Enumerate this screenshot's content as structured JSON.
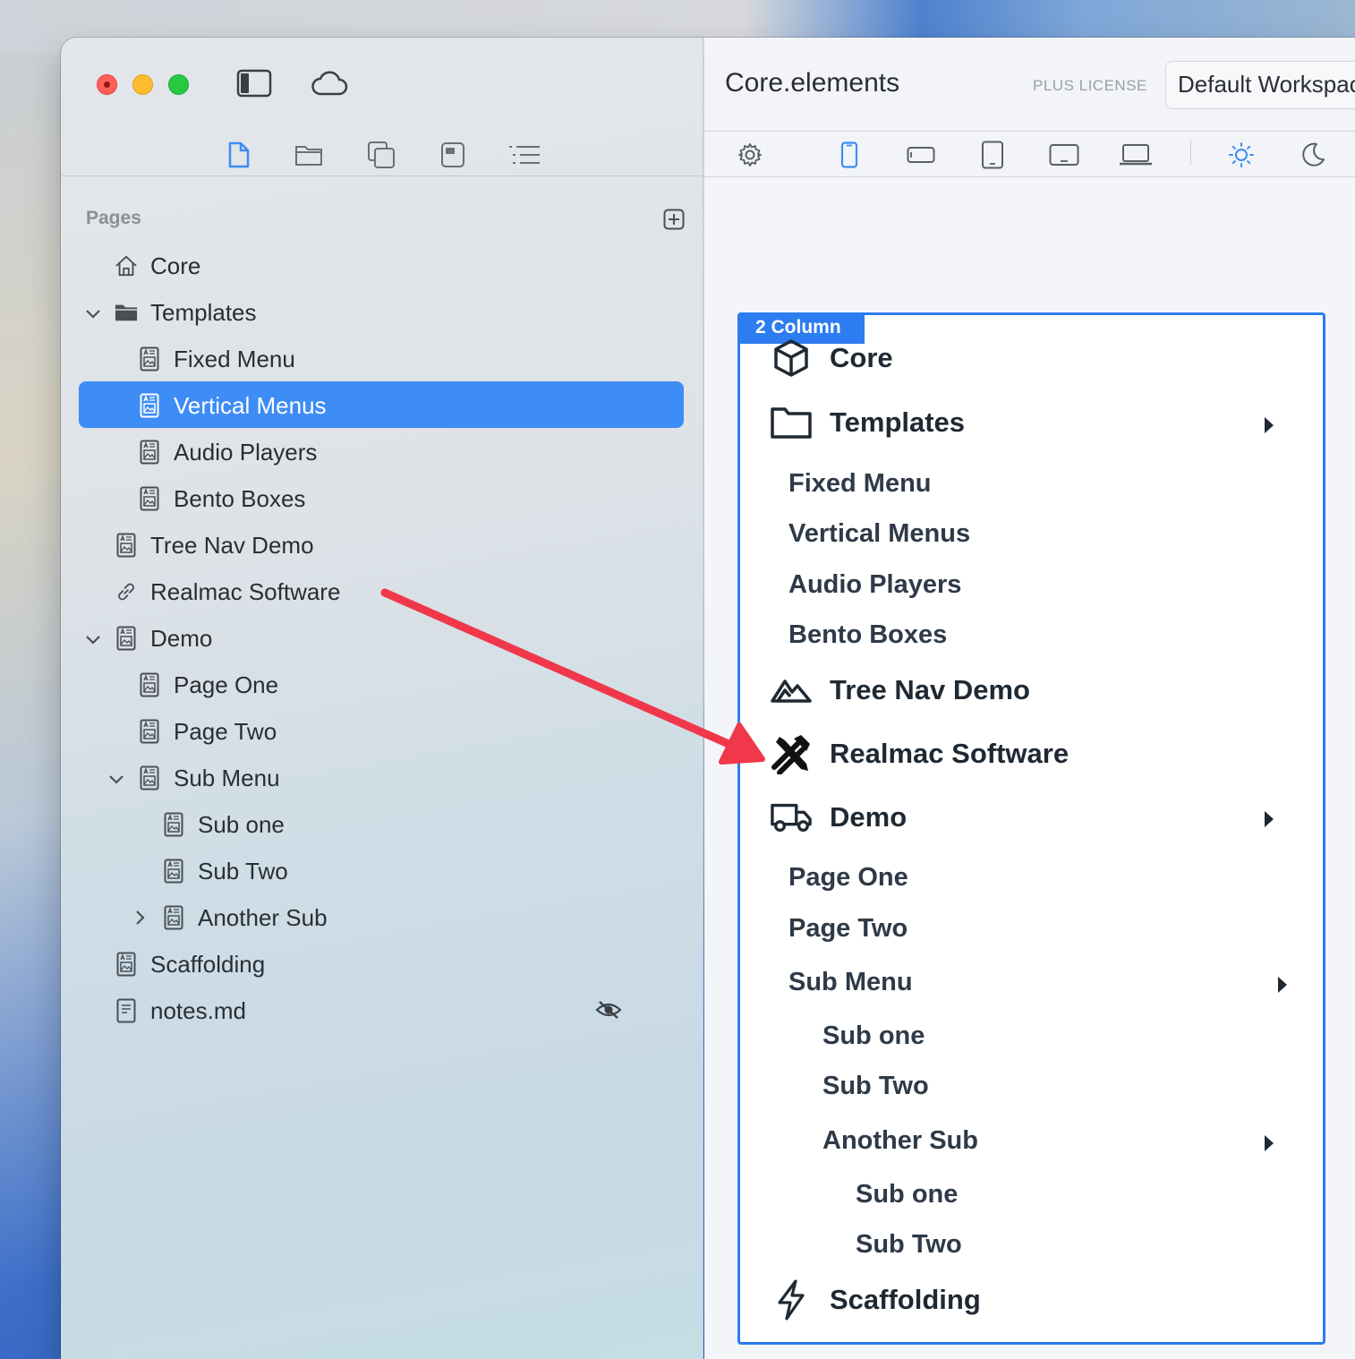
{
  "window": {
    "title": "Core.elements",
    "license": "PLUS LICENSE",
    "workspace": "Default Workspace"
  },
  "toolbar": {
    "left_icons": [
      "sidebar-toggle-icon",
      "cloud-icon"
    ],
    "tabs": [
      "page-icon",
      "folder-icon",
      "copy-icon",
      "panel-icon",
      "outline-icon"
    ],
    "device_icons": [
      "gear-icon",
      "phone-icon",
      "phone-landscape-icon",
      "tablet-icon",
      "tablet-landscape-icon",
      "laptop-icon",
      "sun-icon",
      "moon-icon"
    ],
    "active_device": "phone-icon",
    "accent": "#3e8cf5"
  },
  "sidebar": {
    "section_label": "Pages",
    "items": [
      {
        "label": "Core"
      },
      {
        "label": "Templates"
      },
      {
        "label": "Fixed Menu"
      },
      {
        "label": "Vertical Menus",
        "selected": true
      },
      {
        "label": "Audio Players"
      },
      {
        "label": "Bento Boxes"
      },
      {
        "label": "Tree Nav Demo"
      },
      {
        "label": "Realmac Software"
      },
      {
        "label": "Demo"
      },
      {
        "label": "Page One"
      },
      {
        "label": "Page Two"
      },
      {
        "label": "Sub Menu"
      },
      {
        "label": "Sub one"
      },
      {
        "label": "Sub Two"
      },
      {
        "label": "Another Sub"
      },
      {
        "label": "Scaffolding"
      },
      {
        "label": "notes.md",
        "hidden": true
      }
    ]
  },
  "preview": {
    "tag": "2 Column",
    "border_color": "#2d7cf0",
    "items": [
      {
        "label": "Core",
        "icon": "box-icon"
      },
      {
        "label": "Templates",
        "icon": "folder-icon"
      },
      {
        "label": "Fixed Menu"
      },
      {
        "label": "Vertical Menus"
      },
      {
        "label": "Audio Players"
      },
      {
        "label": "Bento Boxes"
      },
      {
        "label": "Tree Nav Demo",
        "icon": "mountain-icon"
      },
      {
        "label": "Realmac Software",
        "icon": "tools-icon"
      },
      {
        "label": "Demo",
        "icon": "truck-icon"
      },
      {
        "label": "Page One"
      },
      {
        "label": "Page Two"
      },
      {
        "label": "Sub Menu"
      },
      {
        "label": "Sub one"
      },
      {
        "label": "Sub Two"
      },
      {
        "label": "Another Sub"
      },
      {
        "label": "Sub one"
      },
      {
        "label": "Sub Two"
      },
      {
        "label": "Scaffolding",
        "icon": "bolt-icon"
      }
    ]
  },
  "annotation": {
    "color": "#f0384a"
  }
}
